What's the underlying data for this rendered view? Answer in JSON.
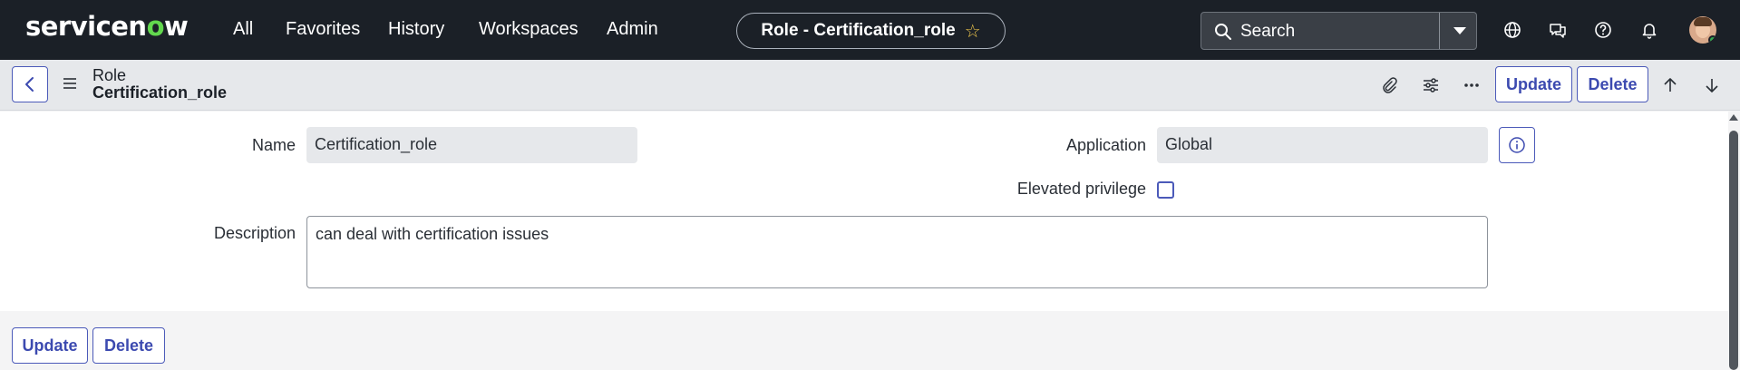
{
  "brand": {
    "logo_text_left": "servicen",
    "logo_text_o": "o",
    "logo_text_right": "w"
  },
  "nav": {
    "all": "All",
    "favorites": "Favorites",
    "history": "History",
    "workspaces": "Workspaces",
    "admin": "Admin"
  },
  "context_pill": {
    "label": "Role - Certification_role",
    "star": "☆"
  },
  "search": {
    "label": "Search"
  },
  "icons": [
    "globe-icon",
    "chat-icon",
    "help-icon",
    "bell-icon",
    "search-icon",
    "attachment-icon",
    "settings-icon",
    "more-icon",
    "up-arrow-icon",
    "down-arrow-icon",
    "info-icon",
    "back-icon",
    "menu-icon"
  ],
  "record": {
    "type": "Role",
    "name": "Certification_role"
  },
  "header_actions": {
    "update": "Update",
    "delete": "Delete"
  },
  "form": {
    "name_label": "Name",
    "name_value": "Certification_role",
    "application_label": "Application",
    "application_value": "Global",
    "elevated_label": "Elevated privilege",
    "elevated_checked": false,
    "description_label": "Description",
    "description_value": "can deal with certification issues"
  },
  "footer_actions": {
    "update": "Update",
    "delete": "Delete"
  },
  "colors": {
    "topbar": "#1b2027",
    "accent": "#4b5ab9",
    "logo_o": "#62d84e",
    "star": "#f2c94c"
  }
}
